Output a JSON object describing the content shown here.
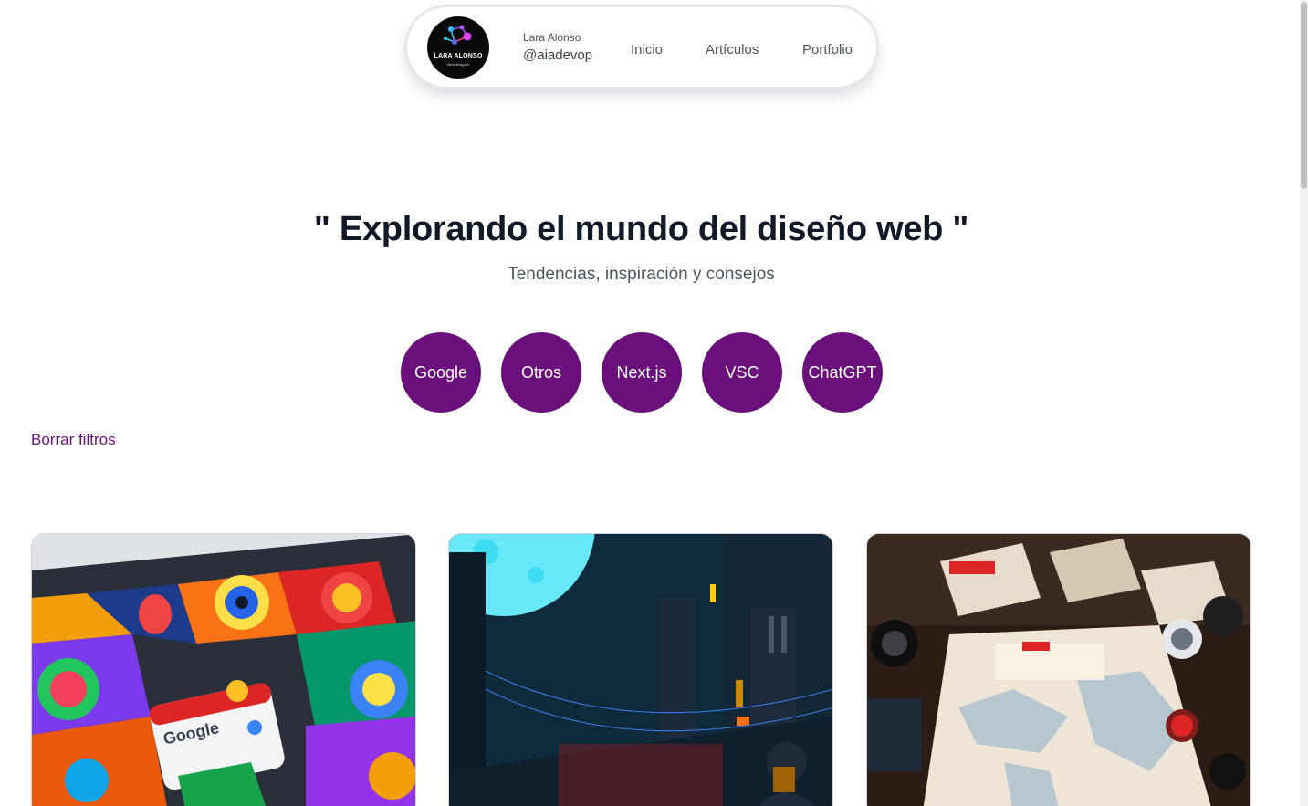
{
  "profile": {
    "logo_text": "LARA ALONSO",
    "logo_subtext": "Web designer",
    "name": "Lara Alonso",
    "handle": "@aiadevop"
  },
  "nav": {
    "items": [
      {
        "label": "Inicio"
      },
      {
        "label": "Artículos"
      },
      {
        "label": "Portfolio"
      }
    ]
  },
  "hero": {
    "title": "\" Explorando el mundo del diseño web \"",
    "subtitle": "Tendencias, inspiración y consejos"
  },
  "filters": {
    "tags": [
      {
        "label": "Google"
      },
      {
        "label": "Otros"
      },
      {
        "label": "Next.js"
      },
      {
        "label": "VSC"
      },
      {
        "label": "ChatGPT"
      }
    ],
    "clear_label": "Borrar filtros"
  },
  "cards": [
    {
      "image": "google-colorful-illustration",
      "image_text": "Google"
    },
    {
      "image": "night-city-moon-illustration"
    },
    {
      "image": "desk-map-illustration"
    }
  ],
  "colors": {
    "accent": "#6b0f7c",
    "title": "#111827",
    "muted": "#4b5563"
  }
}
